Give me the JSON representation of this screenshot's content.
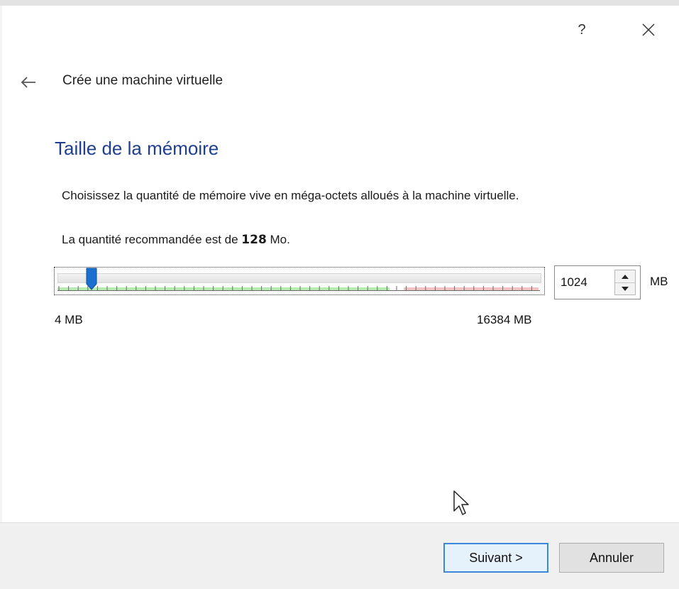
{
  "window": {
    "help_label": "?",
    "close_label": "✕"
  },
  "wizard": {
    "title": "Crée une machine virtuelle"
  },
  "page": {
    "heading": "Taille de la mémoire",
    "description": "Choisissez la quantité de mémoire vive en méga-octets alloués à la machine virtuelle.",
    "recommended_prefix": "La quantité recommandée est de ",
    "recommended_value": "128",
    "recommended_suffix": " Mo."
  },
  "memory": {
    "value": "1024",
    "unit": "MB",
    "min_label": "4 MB",
    "max_label": "16384 MB",
    "min_mb": 4,
    "max_mb": 16384,
    "current_mb": 1024
  },
  "footer": {
    "next_label": "Suivant >",
    "cancel_label": "Annuler"
  },
  "colors": {
    "heading": "#1f3f8f",
    "thumb": "#1b6fd0",
    "safe_zone": "#b7ecb0",
    "warn_zone": "#f3c3c3",
    "primary_border": "#3c87d7"
  },
  "icons": {
    "back": "arrow-left-icon",
    "help": "question-mark-icon",
    "close": "close-icon",
    "spin_up": "triangle-up-icon",
    "spin_down": "triangle-down-icon",
    "cursor": "mouse-pointer-icon"
  }
}
